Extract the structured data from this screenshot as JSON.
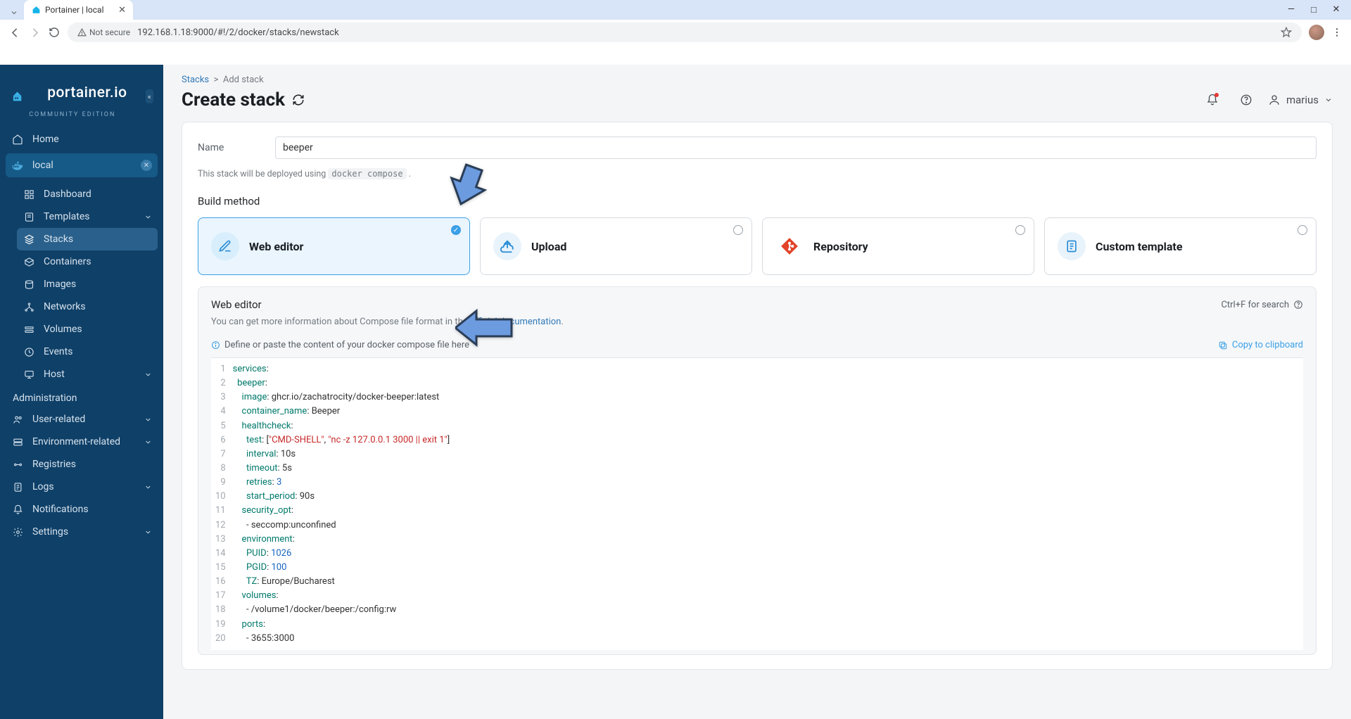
{
  "browser": {
    "tab_title": "Portainer | local",
    "url_security": "Not secure",
    "url": "192.168.1.18:9000/#!/2/docker/stacks/newstack"
  },
  "sidebar": {
    "brand": "portainer.io",
    "brand_sub": "COMMUNITY EDITION",
    "home": "Home",
    "env_name": "local",
    "items": {
      "dashboard": "Dashboard",
      "templates": "Templates",
      "stacks": "Stacks",
      "containers": "Containers",
      "images": "Images",
      "networks": "Networks",
      "volumes": "Volumes",
      "events": "Events",
      "host": "Host"
    },
    "admin_title": "Administration",
    "admin": {
      "user_related": "User-related",
      "env_related": "Environment-related",
      "registries": "Registries",
      "logs": "Logs",
      "notifications": "Notifications",
      "settings": "Settings"
    }
  },
  "header": {
    "breadcrumb_root": "Stacks",
    "breadcrumb_current": "Add stack",
    "title": "Create stack",
    "user": "marius"
  },
  "form": {
    "name_label": "Name",
    "name_value": "beeper",
    "deploy_note_prefix": "This stack will be deployed using ",
    "deploy_note_code": "docker compose",
    "deploy_note_suffix": " .",
    "build_method_title": "Build method",
    "methods": {
      "web_editor": "Web editor",
      "upload": "Upload",
      "repository": "Repository",
      "custom_template": "Custom template"
    }
  },
  "editor": {
    "title": "Web editor",
    "search_hint": "Ctrl+F for search",
    "desc_prefix": "You can get more information about Compose file format in the ",
    "desc_link": "official documentation",
    "desc_suffix": ".",
    "placeholder_hint": "Define or paste the content of your docker compose file here",
    "copy": "Copy to clipboard",
    "lines": [
      "services:",
      "  beeper:",
      "    image: ghcr.io/zachatrocity/docker-beeper:latest",
      "    container_name: Beeper",
      "    healthcheck:",
      "      test: [\"CMD-SHELL\", \"nc -z 127.0.0.1 3000 || exit 1\"]",
      "      interval: 10s",
      "      timeout: 5s",
      "      retries: 3",
      "      start_period: 90s",
      "    security_opt:",
      "      - seccomp:unconfined",
      "    environment:",
      "      PUID: 1026",
      "      PGID: 100",
      "      TZ: Europe/Bucharest",
      "    volumes:",
      "      - /volume1/docker/beeper:/config:rw",
      "    ports:",
      "      - 3655:3000"
    ]
  }
}
